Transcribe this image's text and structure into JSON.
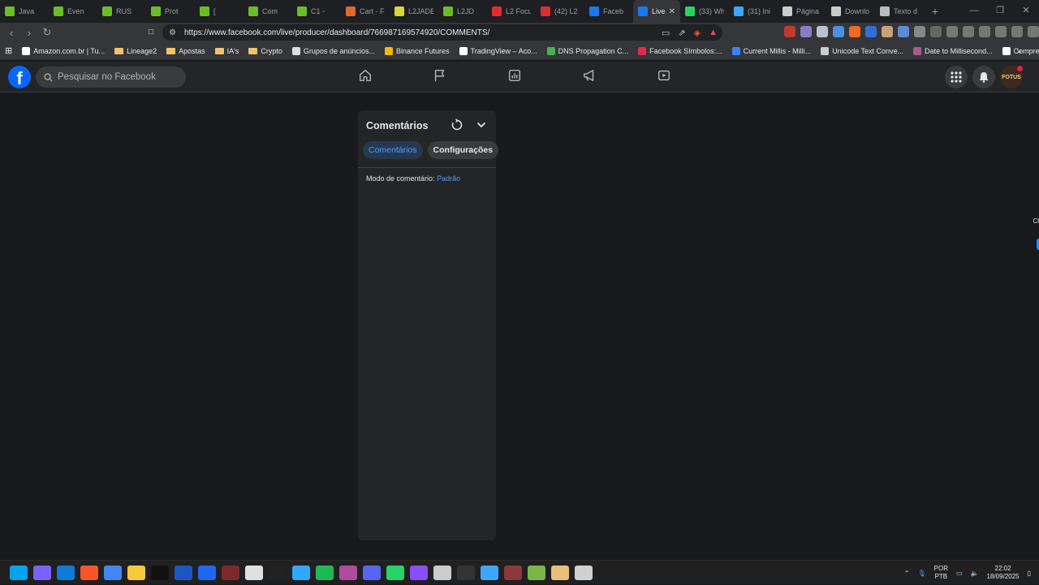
{
  "browser": {
    "tabs": [
      {
        "label": "Java",
        "color": "#6bbd28"
      },
      {
        "label": "Even",
        "color": "#6bbd28"
      },
      {
        "label": "RUS",
        "color": "#6bbd28"
      },
      {
        "label": "Prot",
        "color": "#6bbd28"
      },
      {
        "label": "[",
        "color": "#6bbd28"
      },
      {
        "label": "Com",
        "color": "#6bbd28"
      },
      {
        "label": "C1 -",
        "color": "#6bbd28"
      },
      {
        "label": "Cart - F",
        "color": "#e06a2d"
      },
      {
        "label": "L2JADE",
        "color": "#d6d63a"
      },
      {
        "label": "L2JD",
        "color": "#6bbd28"
      },
      {
        "label": "L2 Focu",
        "color": "#e02c2c"
      },
      {
        "label": "(42) L2",
        "color": "#e02c2c"
      },
      {
        "label": "Faceb",
        "color": "#1877f2"
      },
      {
        "label": "Live",
        "color": "#1877f2",
        "active": true
      },
      {
        "label": "(33) Wh",
        "color": "#25d366"
      },
      {
        "label": "(31) Ini",
        "color": "#3ea6ff"
      },
      {
        "label": "Página",
        "color": "#cccccc"
      },
      {
        "label": "Downlo",
        "color": "#cccccc"
      },
      {
        "label": "Texto d",
        "color": "#bbbbbb"
      }
    ],
    "url": "https://www.facebook.com/live/producer/dashboard/766987169574920/COMMENTS/",
    "bookmarks": [
      {
        "label": "Amazon.com.br | Tu...",
        "color": "#ffffff"
      },
      {
        "label": "Lineage2",
        "folder": true
      },
      {
        "label": "Apostas",
        "folder": true
      },
      {
        "label": "IA's",
        "folder": true
      },
      {
        "label": "Crypto",
        "folder": true
      },
      {
        "label": "Grupos de anúncios...",
        "color": "#dddddd"
      },
      {
        "label": "Binance Futures",
        "color": "#f0b90b"
      },
      {
        "label": "TradingView – Aco...",
        "color": "#ffffff"
      },
      {
        "label": "DNS Propagation C...",
        "color": "#4caf50"
      },
      {
        "label": "Facebook Símbolos:...",
        "color": "#e02c4c"
      },
      {
        "label": "Current Millis - Milli...",
        "color": "#3b82f6"
      },
      {
        "label": "Unicode Text Conve...",
        "color": "#cccccc"
      },
      {
        "label": "Date to Millisecond...",
        "color": "#a85b8c"
      },
      {
        "label": "Compre criptomoed...",
        "color": "#ffffff"
      }
    ]
  },
  "facebook": {
    "search_placeholder": "Pesquisar no Facebook",
    "avatar_text": "FOTUS"
  },
  "panel": {
    "title": "Comentários",
    "tab_comments": "Comentários",
    "tab_settings": "Configurações",
    "mode_label": "Modo de comentário:",
    "mode_value": "Padrão"
  },
  "edge": {
    "label": "Cl"
  },
  "taskbar": {
    "language": "POR",
    "layout": "PTB",
    "time": "22:02",
    "date": "18/09/2025",
    "icons": [
      "#00a4ef",
      "#7b61ff",
      "#0f7bd8",
      "#fb542b",
      "#4285f4",
      "#f8c73a",
      "#111111",
      "#1b57c4",
      "#1e66f5",
      "#7a2a2a",
      "#e0e0e0",
      "#222222",
      "#31a8ff",
      "#1db954",
      "#b04a9e",
      "#5865f2",
      "#25d366",
      "#8a4dff",
      "#cccccc",
      "#333333",
      "#3ea6ff",
      "#8a3a3a",
      "#7ab648",
      "#e8c07a",
      "#d0d0d0"
    ]
  }
}
